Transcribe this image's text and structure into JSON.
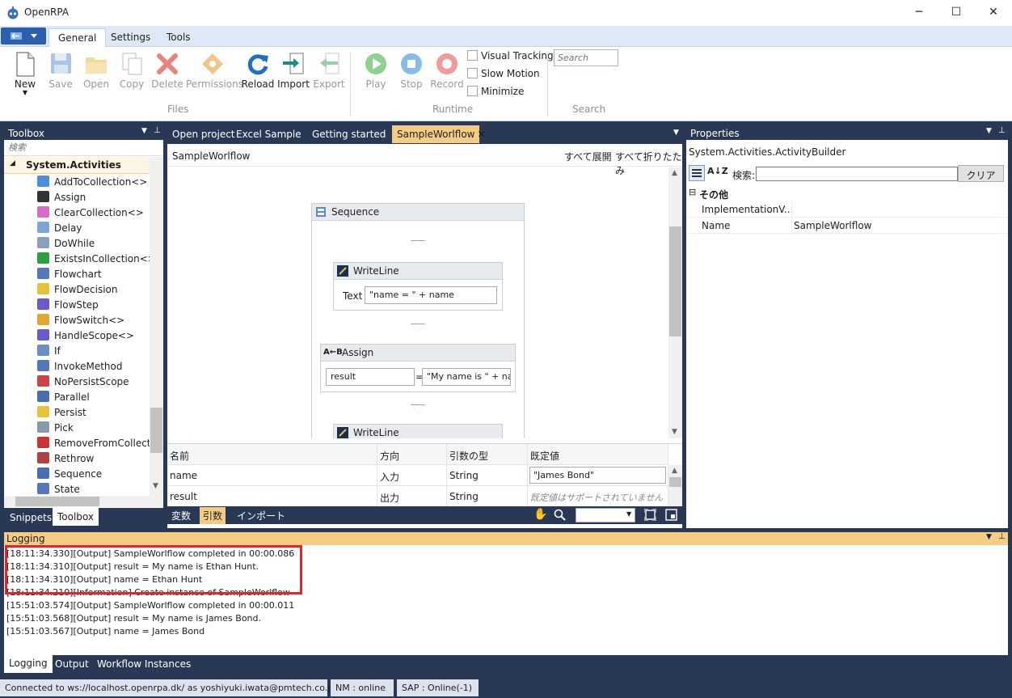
{
  "window": {
    "title": "OpenRPA",
    "minimize": "─",
    "maximize": "☐",
    "close": "✕"
  },
  "ribbon": {
    "tabs": [
      "General",
      "Settings",
      "Tools"
    ],
    "buttons": {
      "new": "New",
      "save": "Save",
      "open": "Open",
      "copy": "Copy",
      "delete": "Delete",
      "permissions": "Permissions",
      "reload": "Reload",
      "import": "Import",
      "export": "Export",
      "play": "Play",
      "stop": "Stop",
      "record": "Record"
    },
    "checkboxes": [
      "Visual Tracking",
      "Slow Motion",
      "Minimize"
    ],
    "search_placeholder": "Search",
    "groups": {
      "files": "Files",
      "runtime": "Runtime",
      "search": "Search"
    }
  },
  "toolbox": {
    "title": "Toolbox",
    "search_placeholder": "検索",
    "category": "System.Activities",
    "items": [
      "AddToCollection<>",
      "Assign",
      "ClearCollection<>",
      "Delay",
      "DoWhile",
      "ExistsInCollection<>",
      "Flowchart",
      "FlowDecision",
      "FlowStep",
      "FlowSwitch<>",
      "HandleScope<>",
      "If",
      "InvokeMethod",
      "NoPersistScope",
      "Parallel",
      "Persist",
      "Pick",
      "RemoveFromCollection<>",
      "Rethrow",
      "Sequence",
      "State"
    ],
    "bottom_tabs": [
      "Snippets",
      "Toolbox"
    ]
  },
  "designer": {
    "tabs": [
      "Open project",
      "Excel Sample",
      "Getting started",
      "SampleWorlflow"
    ],
    "breadcrumb": "SampleWorlflow",
    "expand_all": "すべて展開",
    "collapse_all": "すべて折りたたみ",
    "sequence_title": "Sequence",
    "writeline1": {
      "title": "WriteLine",
      "text_label": "Text",
      "text_value": "\"name = \" + name"
    },
    "assign": {
      "title": "Assign",
      "to": "result",
      "eq": "=",
      "value": "\"My name is \" + na"
    },
    "writeline2": {
      "title": "WriteLine"
    },
    "args": {
      "headers": [
        "名前",
        "方向",
        "引数の型",
        "既定値"
      ],
      "rows": [
        {
          "name": "name",
          "direction": "入力",
          "type": "String",
          "default": "\"James Bond\""
        },
        {
          "name": "result",
          "direction": "出力",
          "type": "String",
          "default": "既定値はサポートされていません"
        }
      ]
    },
    "bottom_tabs": [
      "変数",
      "引数",
      "インポート"
    ]
  },
  "properties": {
    "title": "Properties",
    "object": "System.Activities.ActivityBuilder",
    "search_label": "検索:",
    "clear_button": "クリア",
    "category": "その他",
    "rows": [
      {
        "name": "ImplementationV...",
        "value": ""
      },
      {
        "name": "Name",
        "value": "SampleWorlflow"
      }
    ]
  },
  "logging": {
    "title": "Logging",
    "lines": [
      "[18:11:34.330][Output] SampleWorlflow completed in 00:00.086",
      "[18:11:34.310][Output] result = My name is Ethan Hunt.",
      "[18:11:34.310][Output] name = Ethan Hunt",
      "[18:11:34.210][Information] Create instance of SampleWorlflow",
      "[15:51:03.574][Output] SampleWorlflow completed in 00:00.011",
      "[15:51:03.568][Output] result = My name is James Bond.",
      "[15:51:03.567][Output] name = James Bond"
    ],
    "bottom_tabs": [
      "Logging",
      "Output",
      "Workflow Instances"
    ]
  },
  "status": {
    "connection": "Connected to ws://localhost.openrpa.dk/ as yoshiyuki.iwata@pmtech.co.jp",
    "nm": "NM : online",
    "sap": "SAP : Online(-1)"
  },
  "colors": {
    "panel_bg": "#293955",
    "tab_active": "#f5cc84",
    "highlight_box": "#e0262b"
  }
}
